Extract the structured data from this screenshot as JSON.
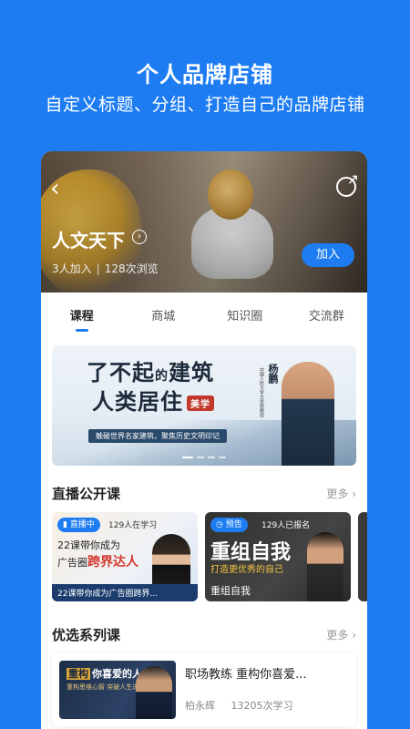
{
  "promo": {
    "title": "个人品牌店铺",
    "subtitle": "自定义标题、分组、打造自己的品牌店铺"
  },
  "shop": {
    "name": "人文天下",
    "members": "3人加入",
    "views": "128次浏览",
    "join_label": "加入",
    "back_icon": "chevron-left-icon",
    "share_icon": "share-icon"
  },
  "tabs": [
    {
      "label": "课程",
      "active": true
    },
    {
      "label": "商城",
      "active": false
    },
    {
      "label": "知识圈",
      "active": false
    },
    {
      "label": "交流群",
      "active": false
    }
  ],
  "banner": {
    "line1_a": "了不起",
    "line1_small": "的",
    "line1_b": "建筑",
    "line2": "人类居住",
    "tag": "美学",
    "strip": "触碰世界名家建筑，聚焦历史文明印记",
    "person_name": "杨鹏",
    "person_desc": "中国人民大学文学院教授",
    "active_slide": 1,
    "slide_count": 4
  },
  "live": {
    "title": "直播公开课",
    "more": "更多",
    "cards": [
      {
        "badge": "直播中",
        "count": "129人在学习",
        "line1": "22课带你成为",
        "line2_a": "广告圈",
        "line2_b": "跨界达人",
        "foot": "22课带你成为广告圈跨界..."
      },
      {
        "badge": "预告",
        "count": "129人已报名",
        "big": "重组自我",
        "sub": "打造更优秀的自己",
        "foot": "重组自我"
      }
    ]
  },
  "series": {
    "title": "优选系列课",
    "more": "更多",
    "items": [
      {
        "thumb_tag": "重构",
        "thumb_title": "你喜爱的人生",
        "thumb_sub": "重构思维心智 突破人生进阶",
        "title": "职场教练 重构你喜爱...",
        "teacher": "柏永辉",
        "learners": "13205次学习"
      }
    ]
  }
}
